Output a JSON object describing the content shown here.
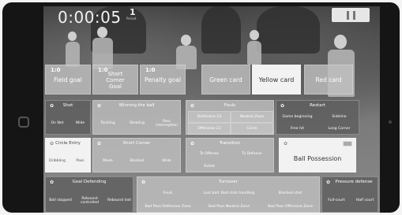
{
  "timer": "0:00:05",
  "period": {
    "number": "1",
    "label": "Period"
  },
  "event_tiles": [
    {
      "num": "1:0",
      "label": "Field goal"
    },
    {
      "num": "1:0",
      "label": "Short Corner Goal"
    },
    {
      "num": "1:0",
      "label": "Penalty goal"
    },
    {
      "num": "",
      "label": "Green card"
    },
    {
      "num": "",
      "label": "Yellow card"
    },
    {
      "num": "",
      "label": "Red card"
    }
  ],
  "shot": {
    "title": "Shot",
    "options": [
      "On Net",
      "Wide"
    ]
  },
  "winning_ball": {
    "title": "Winning the ball",
    "options": [
      "Tackling",
      "Stealing",
      "Pass interception"
    ]
  },
  "fouls": {
    "title": "Fouls",
    "options": [
      "Defensive 23",
      "Neutral Zone",
      "Offensive 23",
      "Circle"
    ]
  },
  "restart": {
    "title": "Restart",
    "options": [
      "Game beginning",
      "Sideline",
      "Free hit",
      "Long Corner"
    ]
  },
  "circle_entry": {
    "title": "Circle Entry",
    "options": [
      "Dribbling",
      "Pass"
    ]
  },
  "short_corner": {
    "title": "Short Corner",
    "options": [
      "Made",
      "Blocked",
      "Wide"
    ]
  },
  "transition": {
    "title": "Transition",
    "options": [
      "To Offense",
      "To Defense",
      "Outlet"
    ]
  },
  "ball_possession": {
    "title": "Ball Possession"
  },
  "goal_defending": {
    "title": "Goal Defending",
    "options": [
      "Ball stopped",
      "Rebound controlled",
      "Rebound lost"
    ]
  },
  "turnover": {
    "title": "Turnover",
    "options": [
      "Fouls",
      "Lost ball: Bad stick handling",
      "Blocked shot",
      "Bad Pass Defensive Zone",
      "Bad Pass Neutral Zone",
      "Bad Pass Offensive Zone"
    ]
  },
  "pressure_defense": {
    "title": "Pressure defense",
    "options": [
      "Full-court",
      "Half court"
    ]
  }
}
